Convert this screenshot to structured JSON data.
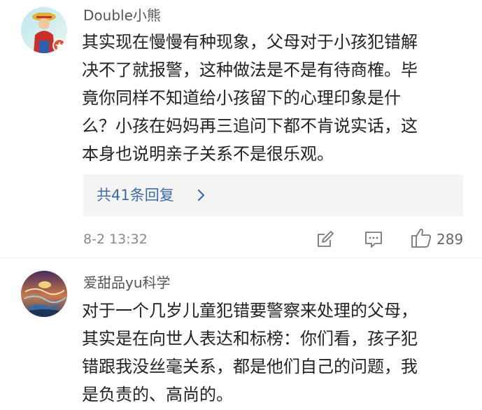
{
  "comments": [
    {
      "username": "Double小熊",
      "text_lines": [
        "其实现在慢慢有种现象，父母对于小孩犯错解",
        "决不了就报警，这种做法是不是有待商榷。毕",
        "竟你同样不知道给小孩留下的心理印象是什",
        "么？小孩在妈妈再三追问下都不肯说实话，这",
        "本身也说明亲子关系不是很乐观。"
      ],
      "replies_label": "共41条回复",
      "timestamp": "8-2 13:32",
      "likes": "289",
      "icons": [
        "edit-icon",
        "comment-icon",
        "thumbs-up-icon",
        "chevron-right-icon"
      ]
    },
    {
      "username": "爱甜品yu科学",
      "text_lines": [
        "对于一个几岁儿童犯错要警察来处理的父母，",
        "其实是在向世人表达和标榜：你们看，孩子犯",
        "错跟我没丝毫关系，都是他们自己的问题，我",
        "是负责的、高尚的。"
      ]
    }
  ],
  "colors": {
    "reply_link": "#3d6ca8",
    "reply_background": "#f4f4f4",
    "username": "#555555",
    "meta": "#888888",
    "body": "#222222"
  }
}
